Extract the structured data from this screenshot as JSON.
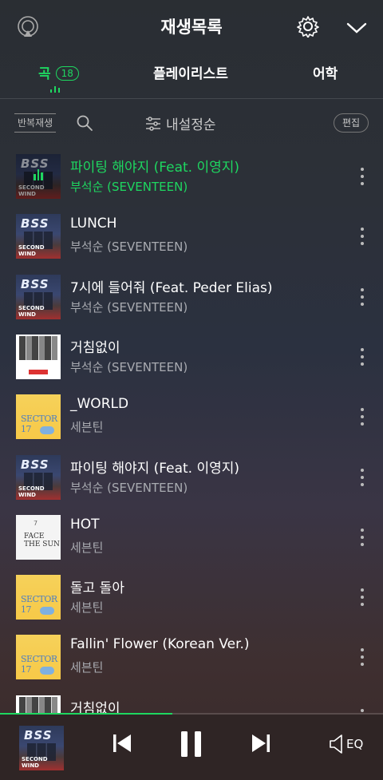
{
  "header": {
    "title": "재생목록"
  },
  "tabs": [
    {
      "label": "곡",
      "count": "18",
      "active": true
    },
    {
      "label": "플레이리스트",
      "active": false
    },
    {
      "label": "어학",
      "active": false
    }
  ],
  "toolbar": {
    "repeat_label": "반복재생",
    "sort_label": "내설정순",
    "edit_label": "편집"
  },
  "songs": [
    {
      "title": "파이팅 해야지 (Feat. 이영지)",
      "artist": "부석순 (SEVENTEEN)",
      "art": "bss",
      "playing": true
    },
    {
      "title": "LUNCH",
      "artist": "부석순 (SEVENTEEN)",
      "art": "bss"
    },
    {
      "title": "7시에 들어줘 (Feat. Peder Elias)",
      "artist": "부석순 (SEVENTEEN)",
      "art": "bss"
    },
    {
      "title": "거침없이",
      "artist": "부석순 (SEVENTEEN)",
      "art": "black"
    },
    {
      "title": "_WORLD",
      "artist": "세븐틴",
      "art": "yellow"
    },
    {
      "title": "파이팅 해야지 (Feat. 이영지)",
      "artist": "부석순 (SEVENTEEN)",
      "art": "bss"
    },
    {
      "title": "HOT",
      "artist": "세븐틴",
      "art": "white"
    },
    {
      "title": "돌고 돌아",
      "artist": "세븐틴",
      "art": "yellow"
    },
    {
      "title": "Fallin' Flower (Korean Ver.)",
      "artist": "세븐틴",
      "art": "yellow"
    },
    {
      "title": "거침없이",
      "artist": "",
      "art": "black"
    }
  ],
  "art_text": {
    "bss_top": "BSS",
    "bss_bottom": "SECOND WIND",
    "yellow_big": "SECTOR 17",
    "white_big": "FACE THE SUN",
    "white_small": "7"
  },
  "player": {
    "progress": 0.45,
    "eq_label": "EQ"
  },
  "colors": {
    "accent": "#1ed760",
    "background_top": "#2a2e33",
    "background_bottom": "#3a2a2a"
  }
}
